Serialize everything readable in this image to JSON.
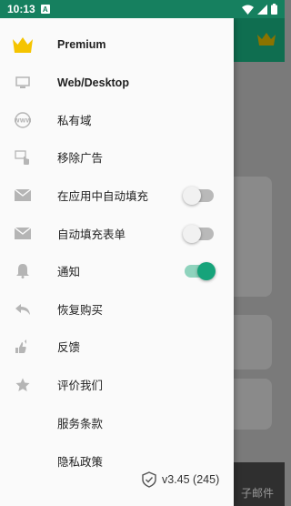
{
  "status_bar": {
    "time": "10:13",
    "notification_badge": "A",
    "icons": [
      "wifi-icon",
      "signal-icon",
      "battery-icon"
    ]
  },
  "background": {
    "bottom_partial_label": "子邮件"
  },
  "drawer": {
    "items": [
      {
        "label": "Premium",
        "icon": "crown-icon",
        "bold": true
      },
      {
        "label": "Web/Desktop",
        "icon": "desktop-icon",
        "bold": true
      },
      {
        "label": "私有域",
        "icon": "www-icon"
      },
      {
        "label": "移除广告",
        "icon": "remove-ads-icon"
      },
      {
        "label": "在应用中自动填充",
        "icon": "mail-icon",
        "toggle": false
      },
      {
        "label": "自动填充表单",
        "icon": "mail-icon",
        "toggle": false
      },
      {
        "label": "通知",
        "icon": "bell-icon",
        "toggle": true
      },
      {
        "label": "恢复购买",
        "icon": "undo-icon"
      },
      {
        "label": "反馈",
        "icon": "feedback-icon"
      },
      {
        "label": "评价我们",
        "icon": "star-icon"
      },
      {
        "label": "服务条款",
        "icon": ""
      },
      {
        "label": "隐私政策",
        "icon": ""
      }
    ],
    "version": "v3.45 (245)",
    "version_icon": "shield-check-icon"
  },
  "colors": {
    "status_bar": "#16805f",
    "accent": "#16a37a",
    "crown": "#f5c400",
    "icon_grey": "#b5b5b5"
  }
}
